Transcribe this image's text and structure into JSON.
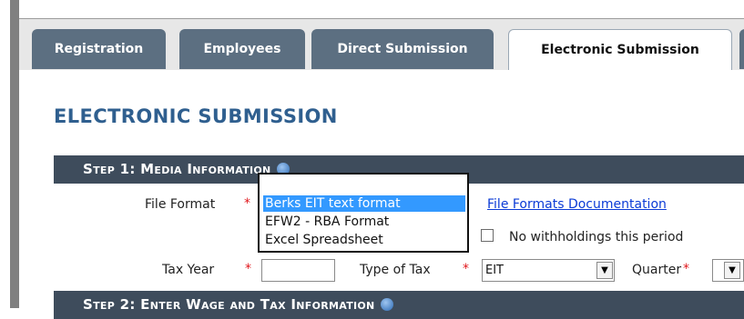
{
  "tabs": [
    {
      "label": "Registration",
      "active": false
    },
    {
      "label": "Employees",
      "active": false
    },
    {
      "label": "Direct Submission",
      "active": false
    },
    {
      "label": "Electronic Submission",
      "active": true
    }
  ],
  "page": {
    "title": "ELECTRONIC SUBMISSION"
  },
  "step1": {
    "title": "Step 1: Media Information"
  },
  "step2": {
    "title": "Step 2: Enter Wage and Tax Information"
  },
  "form": {
    "file_format_label": "File Format",
    "required_marker": "*",
    "file_format_options": [
      "Berks EIT text format",
      "EFW2 - RBA Format",
      "Excel Spreadsheet"
    ],
    "file_format_selected": "Berks EIT text format",
    "docs_link": "File Formats Documentation",
    "no_withholdings_label": "No withholdings this period",
    "no_withholdings_checked": false,
    "tax_year_label": "Tax Year",
    "tax_year_value": "",
    "type_of_tax_label": "Type of Tax",
    "type_of_tax_value": "EIT",
    "quarter_label": "Quarter",
    "quarter_value": ""
  },
  "icons": {
    "help": "help-icon",
    "dropdown": "chevron-down-icon"
  },
  "colors": {
    "tab_inactive": "#5c6f81",
    "title_blue": "#2f5f8f",
    "step_bar": "#3e4c5c",
    "required": "#e0161b",
    "link": "#0b3bd6",
    "selection": "#3399ff"
  }
}
